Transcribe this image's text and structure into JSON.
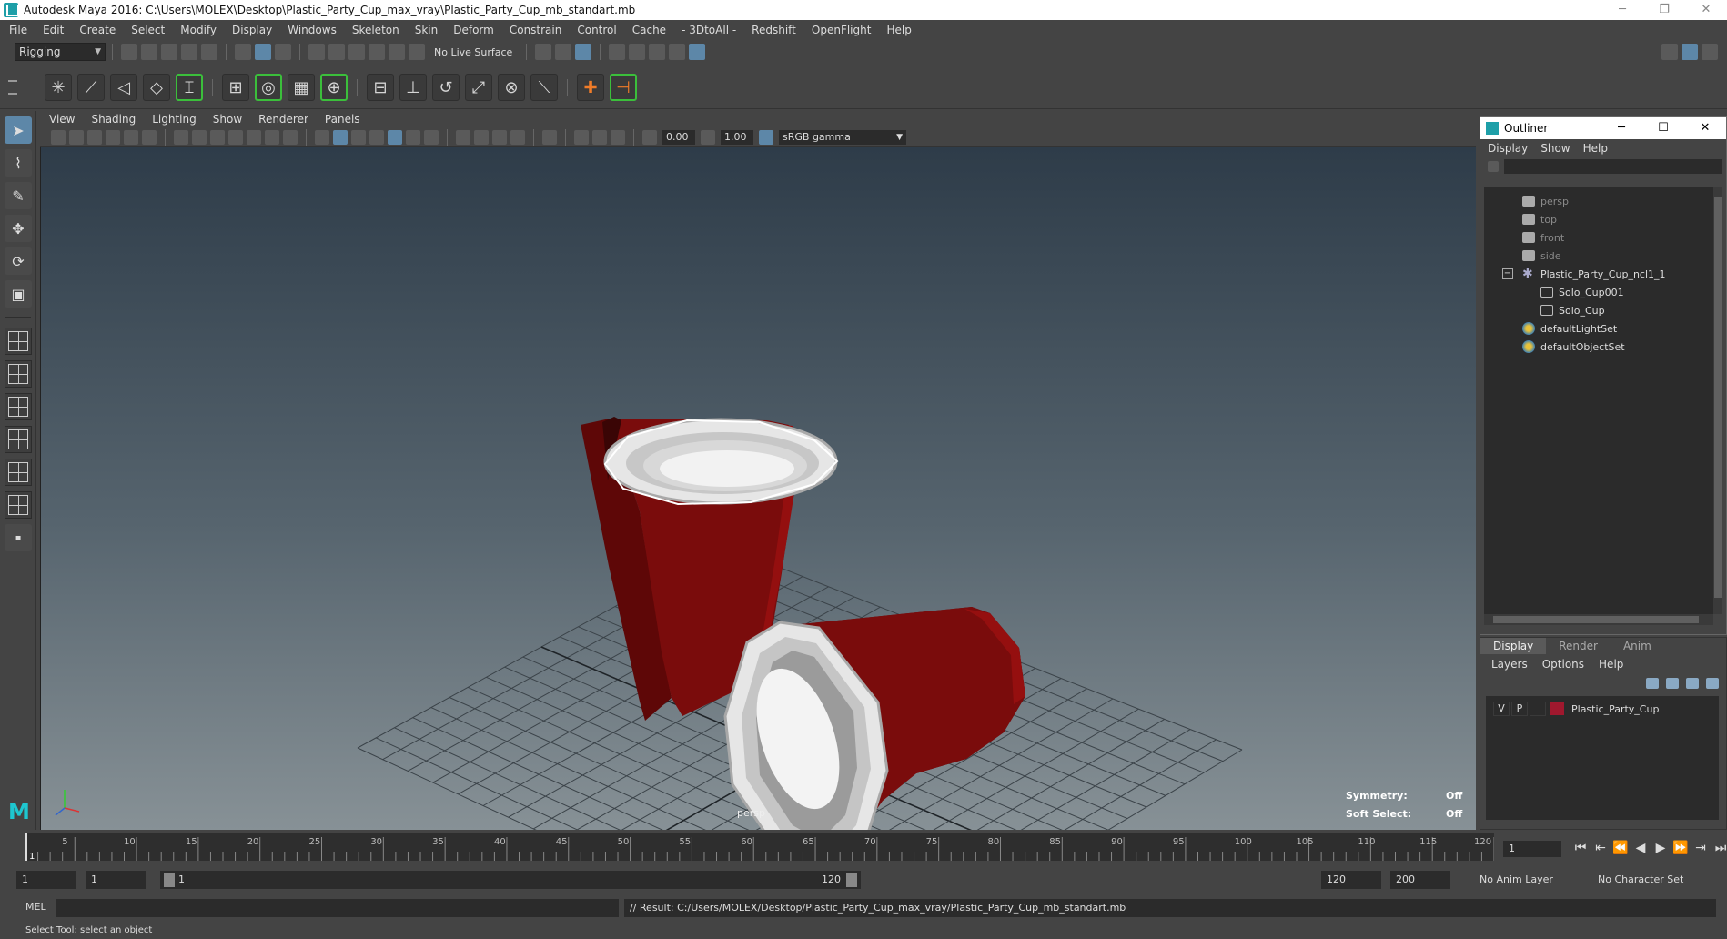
{
  "window": {
    "title": "Autodesk Maya 2016: C:\\Users\\MOLEX\\Desktop\\Plastic_Party_Cup_max_vray\\Plastic_Party_Cup_mb_standart.mb",
    "minimize": "─",
    "restore": "❐",
    "close": "✕"
  },
  "menubar": [
    "File",
    "Edit",
    "Create",
    "Select",
    "Modify",
    "Display",
    "Windows",
    "Skeleton",
    "Skin",
    "Deform",
    "Constrain",
    "Control",
    "Cache",
    "- 3DtoAll -",
    "Redshift",
    "OpenFlight",
    "Help"
  ],
  "statusline": {
    "menu_set": "Rigging",
    "live_surface": "No Live Surface"
  },
  "panel": {
    "menu": [
      "View",
      "Shading",
      "Lighting",
      "Show",
      "Renderer",
      "Panels"
    ],
    "exposure": "0.00",
    "gamma": "1.00",
    "color_space": "sRGB gamma"
  },
  "viewport": {
    "camera": "persp",
    "symmetry_label": "Symmetry:",
    "symmetry_value": "Off",
    "soft_select_label": "Soft Select:",
    "soft_select_value": "Off",
    "cup_color": "#7a0c0c",
    "cup_rim_color": "#e6e6e6"
  },
  "outliner": {
    "title": "Outliner",
    "menu": [
      "Display",
      "Show",
      "Help"
    ],
    "items": [
      {
        "label": "persp",
        "type": "camera",
        "dim": true
      },
      {
        "label": "top",
        "type": "camera",
        "dim": true
      },
      {
        "label": "front",
        "type": "camera",
        "dim": true
      },
      {
        "label": "side",
        "type": "camera",
        "dim": true
      },
      {
        "label": "Plastic_Party_Cup_ncl1_1",
        "type": "group"
      },
      {
        "label": "Solo_Cup001",
        "type": "mesh"
      },
      {
        "label": "Solo_Cup",
        "type": "mesh"
      },
      {
        "label": "defaultLightSet",
        "type": "set"
      },
      {
        "label": "defaultObjectSet",
        "type": "set"
      }
    ],
    "collapse_symbol": "−"
  },
  "layer_editor": {
    "tabs": [
      "Display",
      "Render",
      "Anim"
    ],
    "menu": [
      "Layers",
      "Options",
      "Help"
    ],
    "layers": [
      {
        "v": "V",
        "p": "P",
        "name": "Plastic_Party_Cup",
        "color": "#a0182e"
      }
    ]
  },
  "timeslider": {
    "ticks": [
      5,
      10,
      15,
      20,
      25,
      30,
      35,
      40,
      45,
      50,
      55,
      60,
      65,
      70,
      75,
      80,
      85,
      90,
      95,
      100,
      105,
      110,
      115,
      120
    ],
    "start": 1,
    "end": 120,
    "current": 1,
    "current_field": "1",
    "buttons": [
      "⏮",
      "⏭̶",
      "⏴|",
      "◀",
      "▶",
      "|⏵",
      "⏭"
    ]
  },
  "rangeslider": {
    "start_field": "1",
    "playback_start_field": "1",
    "range_start_label": "1",
    "range_end_label": "120",
    "playback_end_field": "120",
    "end_field": "200",
    "anim_layer": "No Anim Layer",
    "character_set": "No Character Set"
  },
  "cmdline": {
    "language": "MEL",
    "result": "// Result: C:/Users/MOLEX/Desktop/Plastic_Party_Cup_max_vray/Plastic_Party_Cup_mb_standart.mb"
  },
  "helpline": {
    "text": "Select Tool: select an object"
  }
}
